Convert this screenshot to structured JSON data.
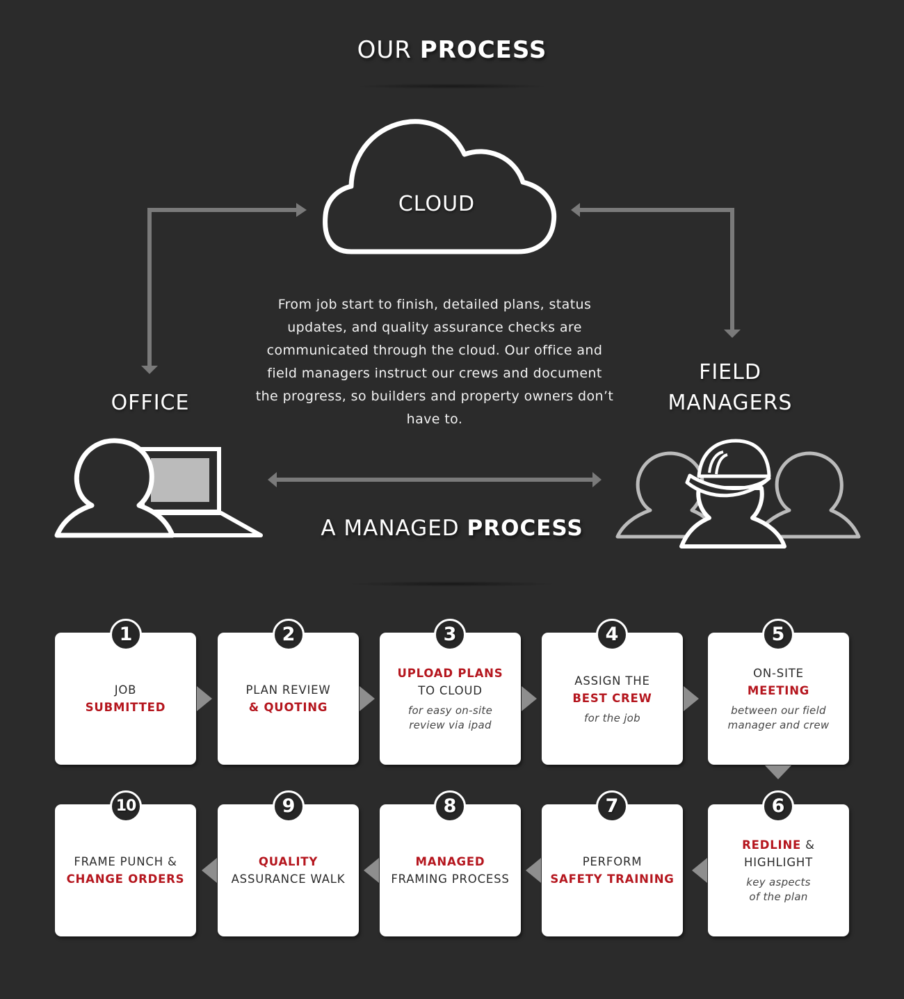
{
  "header": {
    "title_light": "OUR",
    "title_bold": "PROCESS"
  },
  "cloud": {
    "label": "CLOUD",
    "icon": "cloud-icon"
  },
  "description": "From job start to finish, detailed plans, status updates, and quality assurance checks are communicated through the cloud. Our office and field managers instruct our crews and document the progress, so builders and property owners don’t have to.",
  "office": {
    "label": "OFFICE",
    "icon": "office-worker-laptop-icon"
  },
  "field": {
    "label_line1": "FIELD",
    "label_line2": "MANAGERS",
    "icon": "field-managers-hardhat-icon"
  },
  "section2": {
    "title_light": "A MANAGED",
    "title_bold": "PROCESS"
  },
  "colors": {
    "background": "#2b2b2b",
    "accent_red": "#b5161e",
    "arrow_gray": "#7a7a7a",
    "card": "#ffffff"
  },
  "steps": [
    {
      "number": "1",
      "line1": "JOB",
      "line1_red": false,
      "line2": "SUBMITTED",
      "line2_red": true,
      "sub": ""
    },
    {
      "number": "2",
      "line1": "PLAN REVIEW",
      "line1_red": false,
      "line2": "& QUOTING",
      "line2_red": true,
      "sub": ""
    },
    {
      "number": "3",
      "line1": "UPLOAD PLANS",
      "line1_red": true,
      "line2": "TO CLOUD",
      "line2_red": false,
      "sub": "for easy on-site review via ipad"
    },
    {
      "number": "4",
      "line1": "ASSIGN THE",
      "line1_red": false,
      "line2": "BEST CREW",
      "line2_red": true,
      "sub": "for the job"
    },
    {
      "number": "5",
      "line1": "ON-SITE",
      "line1_red": false,
      "line2": "MEETING",
      "line2_red": true,
      "sub": "between our field manager and crew"
    },
    {
      "number": "6",
      "line1_red_part": "REDLINE",
      "line1_rest": " &",
      "line2": "HIGHLIGHT",
      "line2_red": false,
      "sub": "key aspects of the plan"
    },
    {
      "number": "7",
      "line1": "PERFORM",
      "line1_red": false,
      "line2": "SAFETY TRAINING",
      "line2_red": true,
      "sub": ""
    },
    {
      "number": "8",
      "line1": "MANAGED",
      "line1_red": true,
      "line2": "FRAMING PROCESS",
      "line2_red": false,
      "sub": ""
    },
    {
      "number": "9",
      "line1": "QUALITY",
      "line1_red": true,
      "line2": "ASSURANCE WALK",
      "line2_red": false,
      "sub": ""
    },
    {
      "number": "10",
      "line1": "FRAME PUNCH &",
      "line1_red": false,
      "line2": "CHANGE ORDERS",
      "line2_red": true,
      "sub": ""
    }
  ]
}
